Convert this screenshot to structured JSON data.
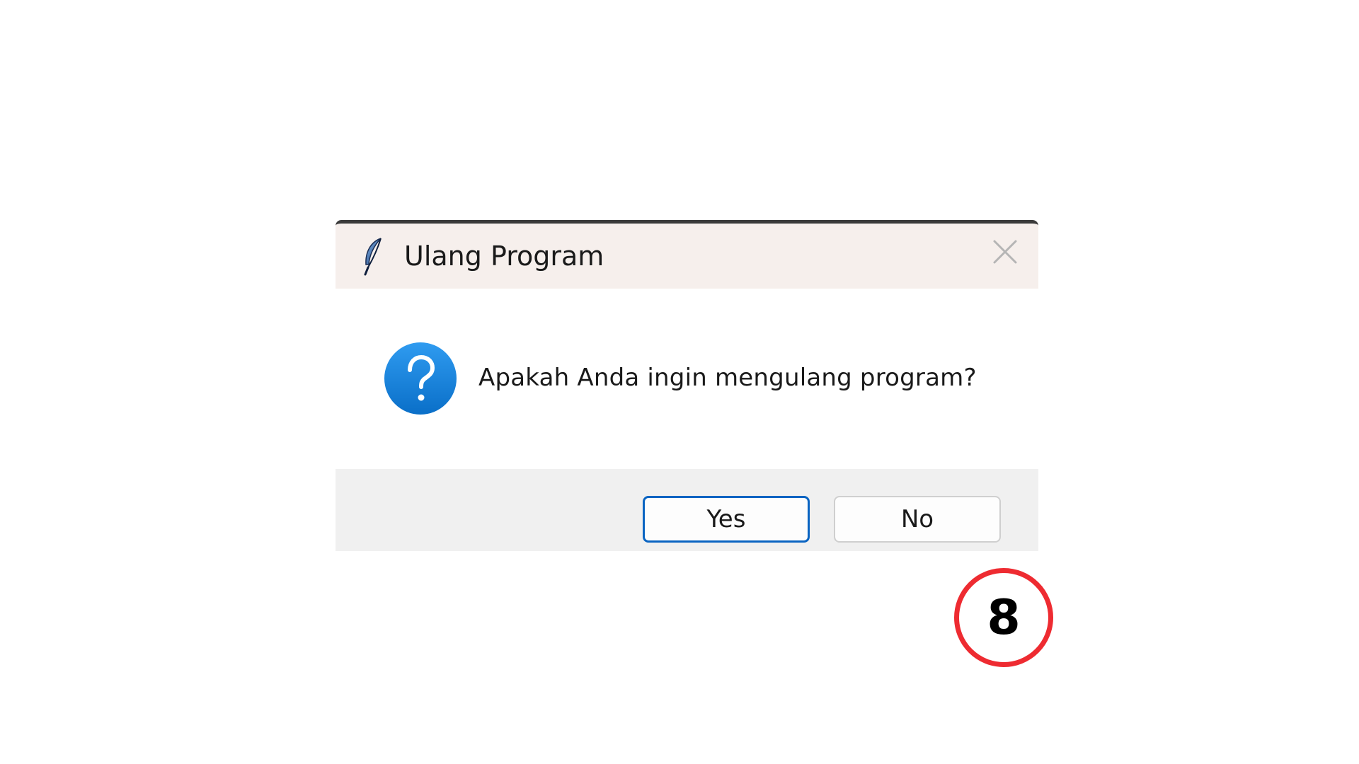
{
  "dialog": {
    "title": "Ulang Program",
    "app_icon": "feather-icon",
    "close_icon": "close-icon",
    "message_icon": "question-icon",
    "message": "Apakah Anda ingin mengulang program?",
    "buttons": {
      "yes_label": "Yes",
      "no_label": "No",
      "default": "Yes"
    }
  },
  "annotation": {
    "step_number": "8",
    "border_color": "#ee2b31"
  },
  "colors": {
    "titlebar_bg": "#f6efec",
    "footer_bg": "#f0f0f0",
    "focus_border": "#0a64c2",
    "question_icon_blue": "#1a86dd"
  }
}
